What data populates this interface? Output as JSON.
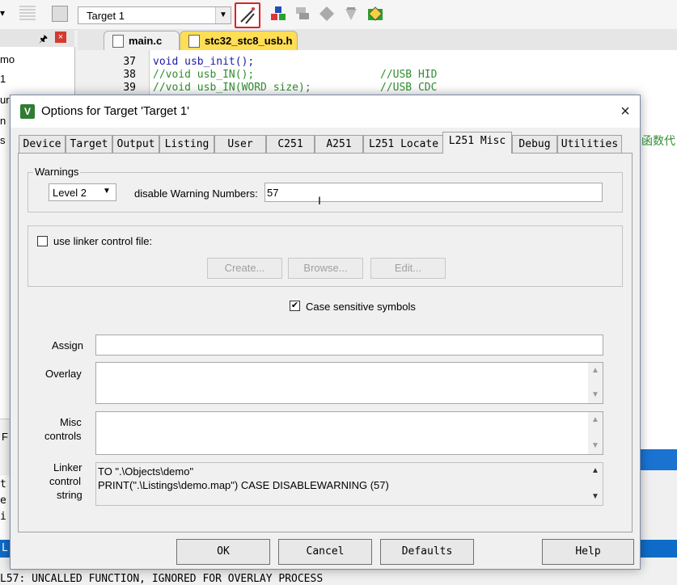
{
  "ide": {
    "target_select": "Target 1",
    "editor_tabs": [
      {
        "label": "main.c"
      },
      {
        "label": "stc32_stc8_usb.h"
      }
    ],
    "project_lines": [
      "mo",
      "1",
      "ur",
      "n",
      "s"
    ],
    "code_lines": [
      {
        "num": "37",
        "text": "void usb_init();",
        "comment": ""
      },
      {
        "num": "38",
        "text": "//void usb_IN();",
        "comment": "//USB HID"
      },
      {
        "num": "39",
        "text": "//void usb_IN(WORD size);",
        "comment": "//USB CDC"
      }
    ],
    "side_chinese": "函数代",
    "left_fragments": [
      "F",
      "t",
      "e",
      "i",
      "L"
    ],
    "build_output": "L57: UNCALLED FUNCTION, IGNORED FOR OVERLAY PROCESS"
  },
  "dialog": {
    "title": "Options for Target 'Target 1'",
    "close_symbol": "×",
    "tabs": [
      "Device",
      "Target",
      "Output",
      "Listing",
      "User",
      "C251",
      "A251",
      "L251 Locate",
      "L251 Misc",
      "Debug",
      "Utilities"
    ],
    "active_tab": "L251 Misc",
    "warnings": {
      "legend": "Warnings",
      "level": "Level 2",
      "disable_label": "disable Warning Numbers:",
      "disable_value": "57"
    },
    "linker_control": {
      "checkbox_label": "use linker control file:",
      "checked": false,
      "create": "Create...",
      "browse": "Browse...",
      "edit": "Edit..."
    },
    "case_sensitive": {
      "label": "Case sensitive symbols",
      "checked": true,
      "check_mark": "✔"
    },
    "assign": {
      "label": "Assign",
      "value": ""
    },
    "overlay": {
      "label": "Overlay",
      "value": ""
    },
    "misc": {
      "label_line1": "Misc",
      "label_line2": "controls",
      "value": ""
    },
    "linker_string": {
      "label_line1": "Linker",
      "label_line2": "control",
      "label_line3": "string",
      "line1": "TO \".\\Objects\\demo\"",
      "line2": "PRINT(\".\\Listings\\demo.map\") CASE DISABLEWARNING (57)"
    },
    "buttons": {
      "ok": "OK",
      "cancel": "Cancel",
      "defaults": "Defaults",
      "help": "Help"
    }
  },
  "colors": {
    "highlight_border": "#e02020",
    "accent_tab": "#ffcc33",
    "status_bar": "#0e6cc8"
  }
}
